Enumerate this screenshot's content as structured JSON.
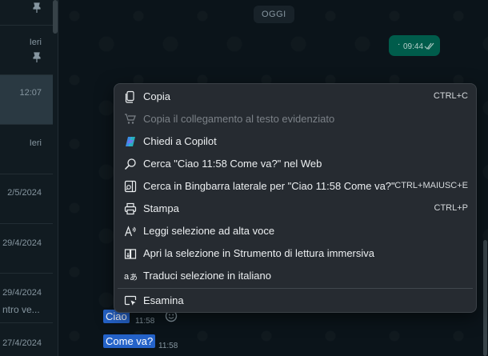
{
  "chat_list": {
    "rows": [
      {
        "time": "",
        "pinned": true
      },
      {
        "time": "Ieri",
        "pinned": true
      },
      {
        "time": "12:07",
        "pinned": false
      },
      {
        "time": "Ieri",
        "pinned": false
      },
      {
        "time": "2/5/2024",
        "pinned": false
      },
      {
        "time": "29/4/2024",
        "pinned": false
      },
      {
        "time": "29/4/2024",
        "pinned": false,
        "snippet": "ntro ve..."
      },
      {
        "time": "27/4/2024",
        "pinned": false
      }
    ]
  },
  "chat": {
    "date_separator": "OGGI",
    "outgoing": {
      "text": "·",
      "time": "09:44",
      "status": "read"
    },
    "incoming": [
      {
        "text": "Ciao",
        "time": "11:58"
      },
      {
        "text": "Come va?",
        "time": "11:58"
      }
    ]
  },
  "context_menu": {
    "items": [
      {
        "icon": "copy-icon",
        "label": "Copia",
        "shortcut": "CTRL+C",
        "disabled": false
      },
      {
        "icon": "link-highlight-icon",
        "label": "Copia il collegamento al testo evidenziato",
        "shortcut": "",
        "disabled": true
      },
      {
        "icon": "copilot-icon",
        "label": "Chiedi a Copilot",
        "shortcut": "",
        "disabled": false
      },
      {
        "icon": "search-icon",
        "label": "Cerca \"Ciao 11:58 Come va?\" nel Web",
        "shortcut": "",
        "disabled": false
      },
      {
        "icon": "sidebar-search-icon",
        "label": "Cerca in Bingbarra laterale per \"Ciao 11:58 Come va?\"",
        "shortcut": "CTRL+MAIUSC+E",
        "disabled": false
      },
      {
        "icon": "printer-icon",
        "label": "Stampa",
        "shortcut": "CTRL+P",
        "disabled": false
      },
      {
        "icon": "read-aloud-icon",
        "label": "Leggi selezione ad alta voce",
        "shortcut": "",
        "disabled": false
      },
      {
        "icon": "immersive-reader-icon",
        "label": "Apri la selezione in Strumento di lettura immersiva",
        "shortcut": "",
        "disabled": false
      },
      {
        "icon": "translate-icon",
        "label": "Traduci selezione in italiano",
        "shortcut": "",
        "disabled": false
      },
      {
        "icon": "inspect-icon",
        "label": "Esamina",
        "shortcut": "",
        "disabled": false
      }
    ]
  },
  "colors": {
    "outgoing_bubble": "#005c4b",
    "selection": "#2563c9",
    "menu_background": "#262b31"
  }
}
